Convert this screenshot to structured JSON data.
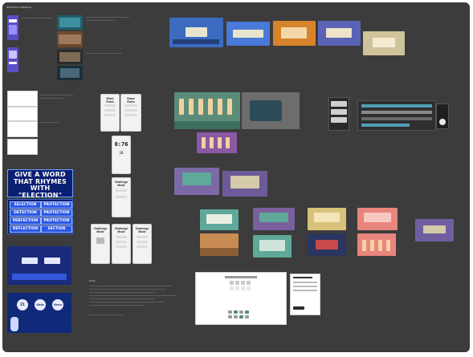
{
  "board": {
    "top_left_label": "Wireframes & Mockups",
    "notes_header": "Notes"
  },
  "headline_card": {
    "text": "GIVE A WORD THAT RHYMES WITH \"ELECTION\""
  },
  "answer_options": [
    {
      "left": "SELECTION",
      "right": "PROTECTION"
    },
    {
      "left": "DETECTION",
      "right": "PROTECTION"
    },
    {
      "left": "PERFECTION",
      "right": "PROTECTION"
    },
    {
      "left": "REFLECTION",
      "right": "SECTION"
    }
  ],
  "timer": {
    "value": "0:76",
    "count": "28"
  },
  "phone_titles": {
    "p1": "Word Rules",
    "p2": "Game Rules",
    "p3": "Challenge Mode",
    "p4": "Challenge Mode",
    "p5": "Challenge Mode",
    "p6": "Challenge Mode"
  },
  "game_bubbles": [
    "21",
    "Meta",
    "Neon"
  ],
  "colors": {
    "board": "#3c3c3c",
    "deep_blue": "#0b1f73",
    "accent_blue": "#2c56e6",
    "teal": "#5a8c79",
    "salmon": "#e8857c"
  }
}
